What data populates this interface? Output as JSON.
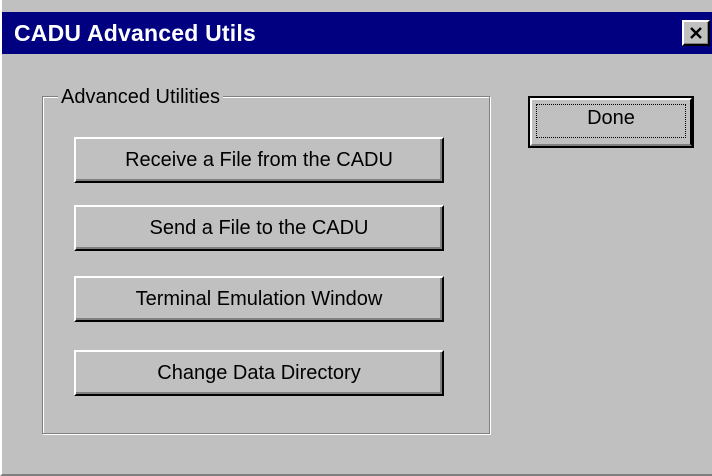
{
  "window": {
    "title": "CADU Advanced Utils",
    "close_icon": "close-icon"
  },
  "group": {
    "label": "Advanced Utilities"
  },
  "buttons": {
    "receive_file": "Receive a File from the CADU",
    "send_file": "Send a File to the CADU",
    "terminal": "Terminal Emulation Window",
    "change_dir": "Change Data Directory",
    "done": "Done"
  },
  "colors": {
    "titlebar": "#000080",
    "face": "#c0c0c0"
  }
}
